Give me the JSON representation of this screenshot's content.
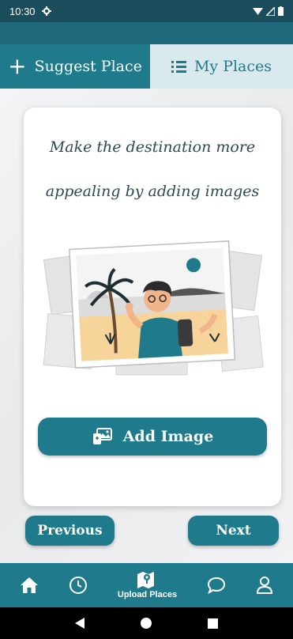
{
  "status_bar": {
    "time": "10:30"
  },
  "tabs": [
    {
      "label": "Suggest Place",
      "icon": "plus-icon",
      "active": true
    },
    {
      "label": "My Places",
      "icon": "list-icon",
      "active": false
    }
  ],
  "card": {
    "title": "Make the destination more appealing by adding images",
    "add_image_label": "Add Image"
  },
  "buttons": {
    "previous": "Previous",
    "next": "Next"
  },
  "bottom_nav": {
    "items": [
      {
        "icon": "home-icon",
        "label": ""
      },
      {
        "icon": "clock-icon",
        "label": ""
      },
      {
        "icon": "map-icon",
        "label": "Upload Places",
        "active": true
      },
      {
        "icon": "chat-icon",
        "label": ""
      },
      {
        "icon": "profile-icon",
        "label": ""
      }
    ]
  },
  "colors": {
    "primary": "#1f7a8c",
    "status_bar": "#1b4d5c",
    "tab_inactive": "#d8eaee"
  }
}
